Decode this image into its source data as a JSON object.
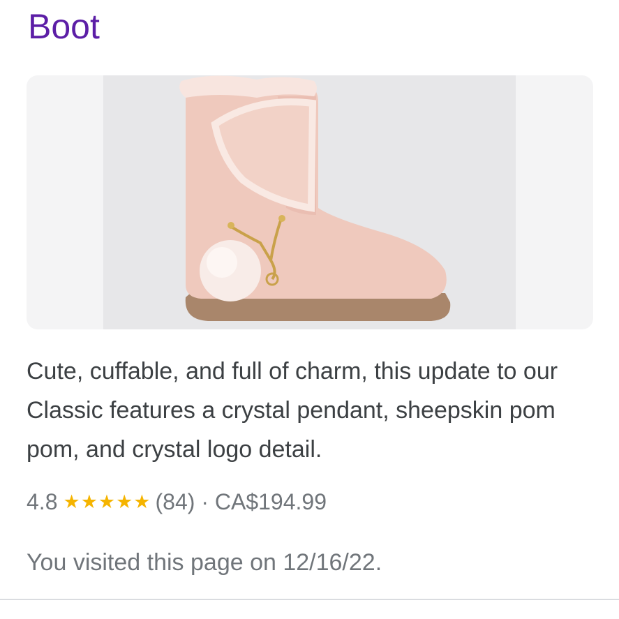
{
  "result": {
    "title": "Boot",
    "description": "Cute, cuffable, and full of charm, this update to our Classic features a crystal pendant, sheepskin pom pom, and crystal logo detail.",
    "rating": "4.8",
    "stars": "★★★★★",
    "rating_value": 4.8,
    "rating_max": 5,
    "review_count": "(84)",
    "separator": " · ",
    "price": "CA$194.99",
    "visited": "You visited this page on 12/16/22."
  },
  "colors": {
    "title": "#5c1ea6",
    "text": "#3c4043",
    "muted": "#70757a",
    "star": "#f5b400",
    "boot": "#efc9bd"
  }
}
